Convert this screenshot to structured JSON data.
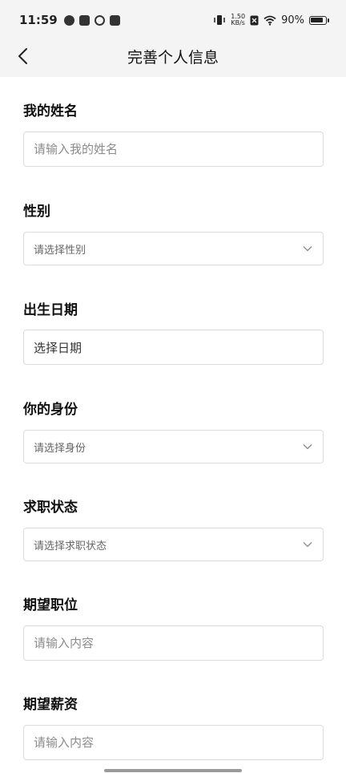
{
  "status_bar": {
    "time": "11:59",
    "net_speed_value": "1.50",
    "net_speed_unit": "KB/s",
    "battery": "90%"
  },
  "header": {
    "title": "完善个人信息"
  },
  "form": {
    "name": {
      "label": "我的姓名",
      "placeholder": "请输入我的姓名"
    },
    "gender": {
      "label": "性别",
      "placeholder": "请选择性别"
    },
    "birthdate": {
      "label": "出生日期",
      "value": "选择日期"
    },
    "identity": {
      "label": "你的身份",
      "placeholder": "请选择身份"
    },
    "job_status": {
      "label": "求职状态",
      "placeholder": "请选择求职状态"
    },
    "desired_position": {
      "label": "期望职位",
      "placeholder": "请输入内容"
    },
    "desired_salary": {
      "label": "期望薪资",
      "placeholder": "请输入内容"
    }
  }
}
